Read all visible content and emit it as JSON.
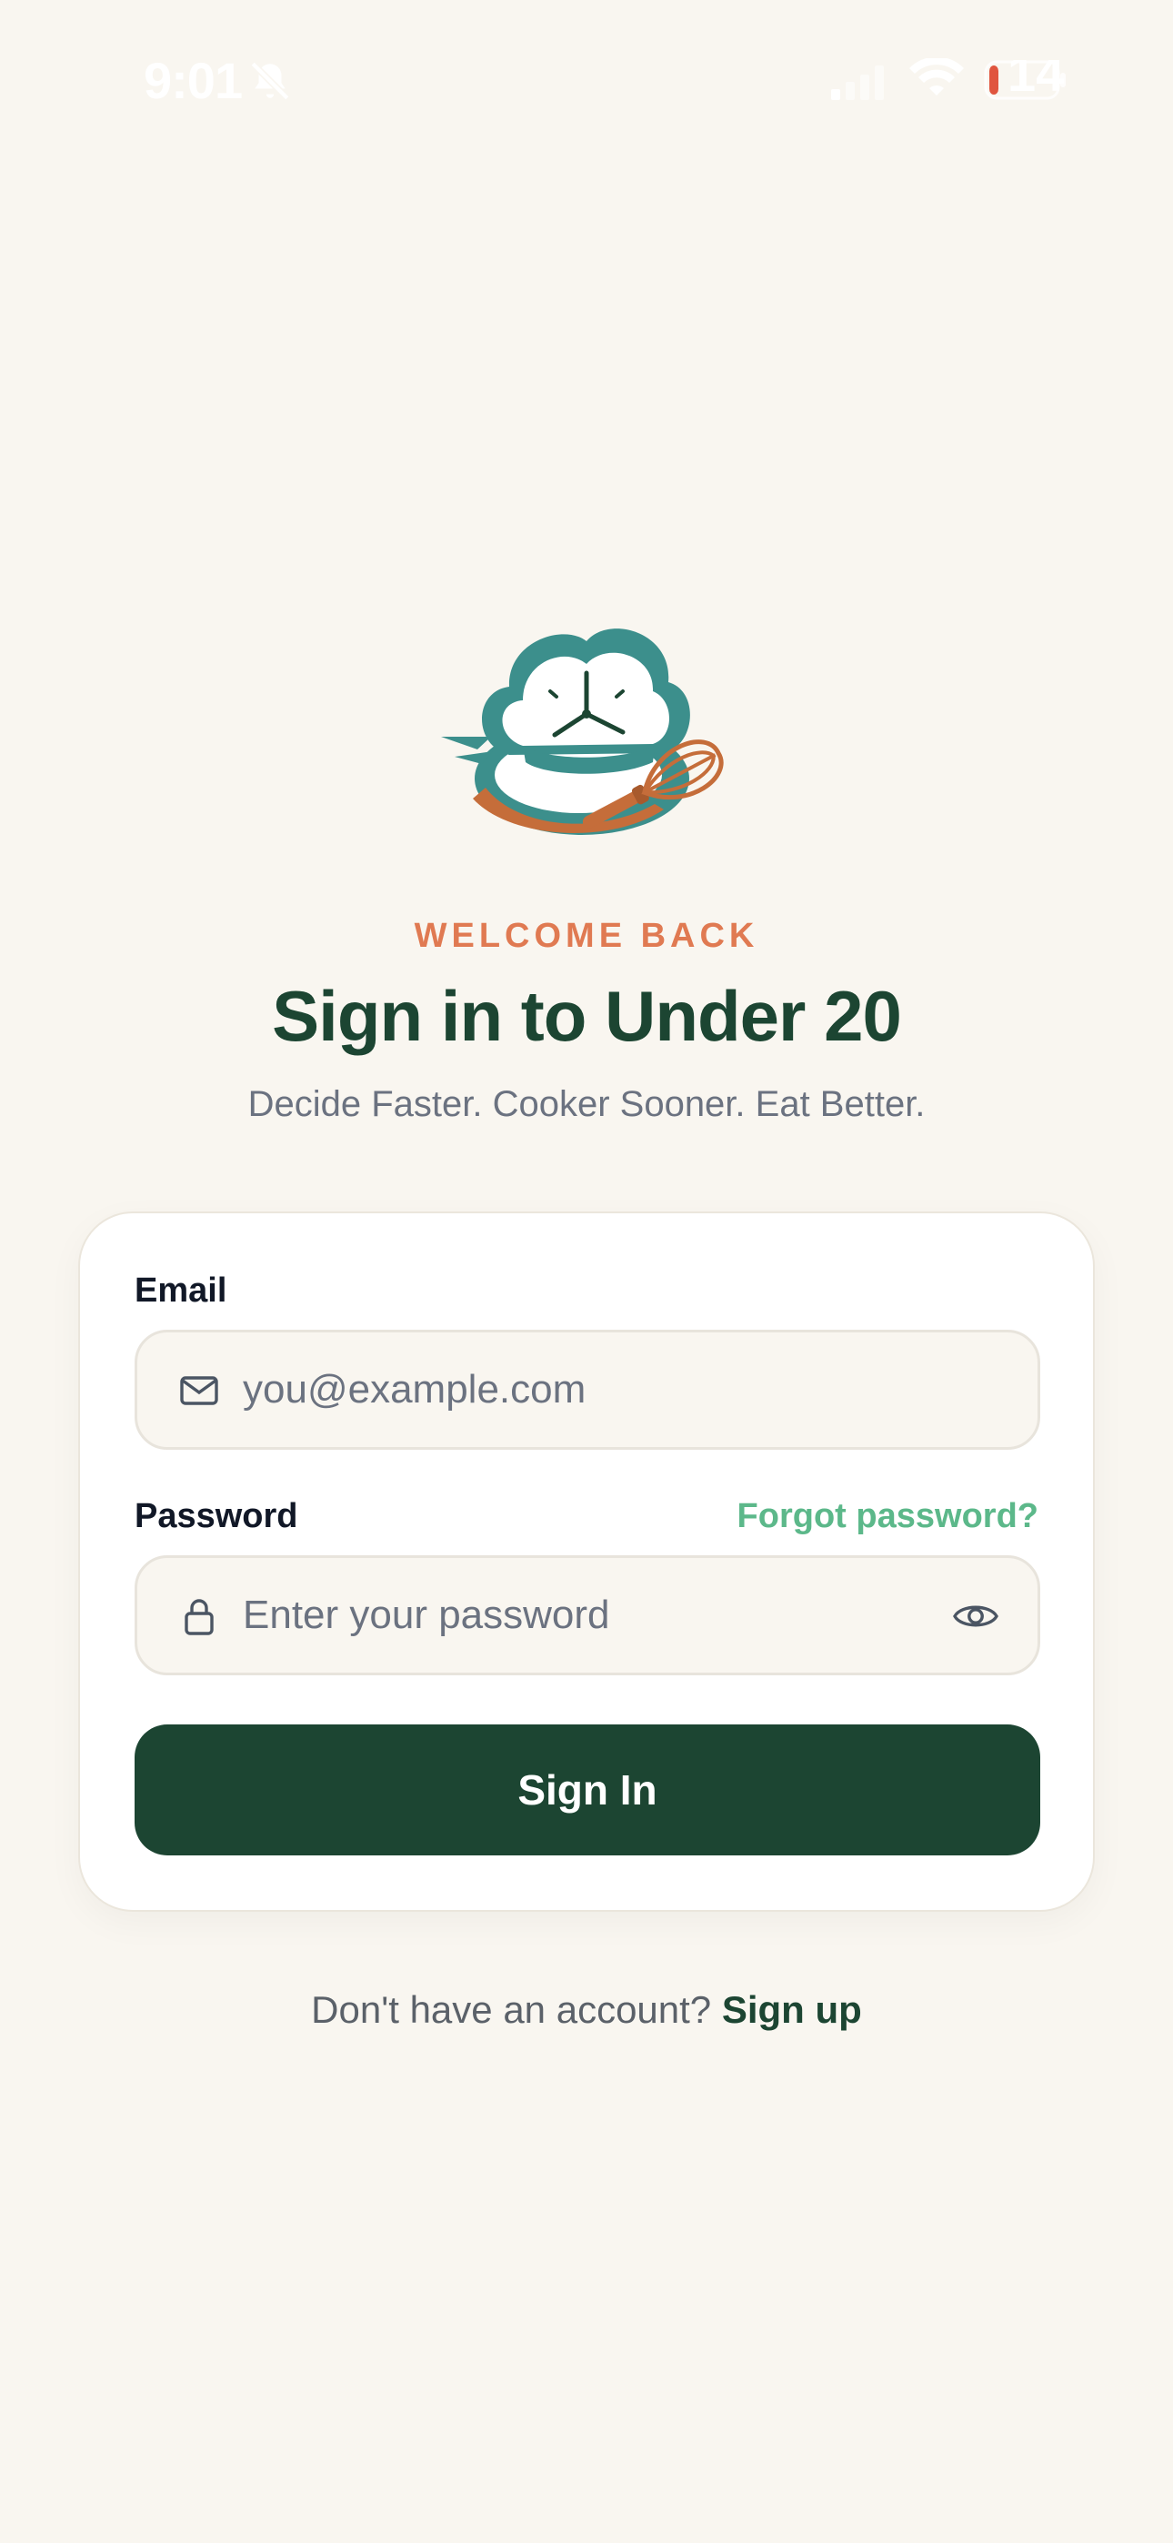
{
  "status_bar": {
    "time": "9:01",
    "battery": "14",
    "icons": [
      "bell-slash-icon",
      "cellular-signal-icon",
      "wifi-icon",
      "battery-charging-icon"
    ]
  },
  "brand": {
    "logo_icon": "chef-hat-clock-whisk-logo",
    "colors": {
      "teal": "#3c8f8c",
      "copper": "#c56d3a",
      "dark_green": "#1c4532",
      "accent_orange": "#e07a52",
      "link_green": "#5cb88a",
      "background": "#f9f6f0"
    }
  },
  "header": {
    "eyebrow": "WELCOME BACK",
    "title": "Sign in to Under 20",
    "subtitle": "Decide Faster. Cooker Sooner. Eat Better."
  },
  "form": {
    "email": {
      "label": "Email",
      "placeholder": "you@example.com",
      "value": "",
      "icon": "mail-icon"
    },
    "password": {
      "label": "Password",
      "placeholder": "Enter your password",
      "value": "",
      "icon": "lock-icon",
      "toggle_icon": "eye-icon"
    },
    "forgot_label": "Forgot password?",
    "submit_label": "Sign In"
  },
  "footer": {
    "prompt": "Don't have an account?",
    "signup_label": "Sign up"
  }
}
